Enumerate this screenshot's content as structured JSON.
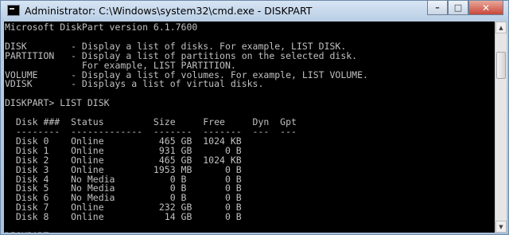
{
  "window": {
    "title": "Administrator: C:\\Windows\\system32\\cmd.exe - DISKPART",
    "icon": "console-icon",
    "controls": {
      "minimize": "–",
      "maximize": "□",
      "close": "✕"
    }
  },
  "console": {
    "lines": [
      "Microsoft DiskPart version 6.1.7600",
      "",
      "DISK        - Display a list of disks. For example, LIST DISK.",
      "PARTITION   - Display a list of partitions on the selected disk.",
      "              For example, LIST PARTITION.",
      "VOLUME      - Display a list of volumes. For example, LIST VOLUME.",
      "VDISK       - Displays a list of virtual disks.",
      "",
      "DISKPART> LIST DISK",
      "",
      "  Disk ###  Status         Size     Free     Dyn  Gpt",
      "  --------  -------------  -------  -------  ---  ---",
      "  Disk 0    Online          465 GB  1024 KB",
      "  Disk 1    Online          931 GB      0 B",
      "  Disk 2    Online          465 GB  1024 KB",
      "  Disk 3    Online         1953 MB      0 B",
      "  Disk 4    No Media          0 B       0 B",
      "  Disk 5    No Media          0 B       0 B",
      "  Disk 6    No Media          0 B       0 B",
      "  Disk 7    Online          232 GB      0 B",
      "  Disk 8    Online           14 GB      0 B",
      "",
      "DISKPART> "
    ]
  },
  "scrollbar": {
    "up_arrow": "▲",
    "down_arrow": "▼"
  }
}
